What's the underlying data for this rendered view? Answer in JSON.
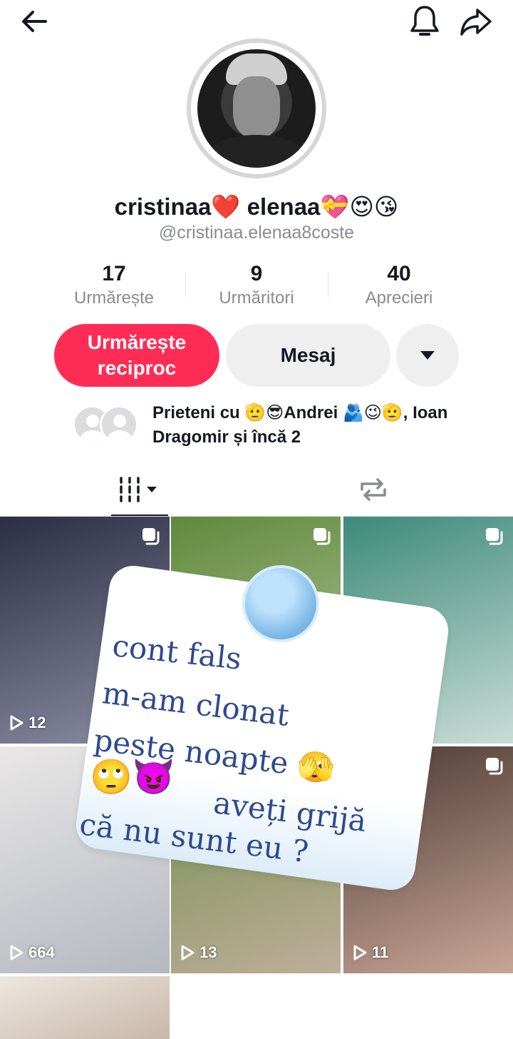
{
  "profile": {
    "display_name": "cristinaa❤️ elenaa💝😍😘",
    "username": "@cristinaa.elenaa8coste"
  },
  "stats": [
    {
      "number": "17",
      "label": "Urmărește"
    },
    {
      "number": "9",
      "label": "Urmăritori"
    },
    {
      "number": "40",
      "label": "Aprecieri"
    }
  ],
  "actions": {
    "follow_back_label": "Urmărește reciproc",
    "message_label": "Mesaj"
  },
  "friends": {
    "text": "Prieteni cu 🫡😎Andrei 🫂😉🫡, Ioan Dragomir și încă 2"
  },
  "grid": [
    {
      "views": "12",
      "multi": true,
      "colors": [
        "#2b2e44",
        "#8c8ea3"
      ]
    },
    {
      "views": "",
      "multi": true,
      "colors": [
        "#5f8a3c",
        "#b9c7a1"
      ]
    },
    {
      "views": "",
      "multi": true,
      "colors": [
        "#3d8a7a",
        "#c9dcd6"
      ]
    },
    {
      "views": "664",
      "multi": false,
      "colors": [
        "#e9e7e6",
        "#b4b8c0"
      ]
    },
    {
      "views": "13",
      "multi": false,
      "colors": [
        "#6f8c4e",
        "#bfae9a"
      ]
    },
    {
      "views": "11",
      "multi": true,
      "colors": [
        "#4d3a34",
        "#c7a595"
      ]
    },
    {
      "views": "",
      "multi": false,
      "colors": [
        "#ede7e1",
        "#c8b7a7"
      ]
    }
  ],
  "overlay": {
    "lines": [
      "cont fals",
      "m-am clonat",
      "peste noapte 🫣",
      "🙄😈",
      "aveți grijă",
      "că nu sunt eu ?"
    ]
  },
  "icons": {
    "back": "arrow-left-icon",
    "bell": "bell-icon",
    "share": "share-icon",
    "more": "caret-down-icon",
    "videos_tab": "grid-icon",
    "reposts_tab": "repost-icon"
  },
  "colors": {
    "accent": "#fe2c55",
    "secondary_text": "#8a8b91",
    "button_gray": "#efeff0"
  }
}
